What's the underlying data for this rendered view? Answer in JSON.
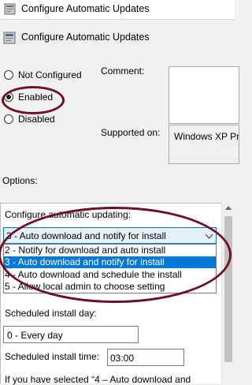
{
  "window": {
    "title": "Configure Automatic Updates",
    "header_title": "Configure Automatic Updates"
  },
  "state": {
    "not_configured_label": "Not Configured",
    "enabled_label": "Enabled",
    "disabled_label": "Disabled",
    "selected": "Enabled"
  },
  "comment_label": "Comment:",
  "supported_on": {
    "label": "Supported on:",
    "value": "Windows XP Pr"
  },
  "options_label": "Options:",
  "options": {
    "configure_label": "Configure automatic updating:",
    "combo_value": "3 - Auto download and notify for install",
    "dropdown_items": [
      "2 - Notify for download and auto install",
      "3 - Auto download and notify for install",
      "4 - Auto download and schedule the install",
      "5 - Allow local admin to choose setting"
    ],
    "selected_index": 1,
    "schedule_day_label": "Scheduled install day:",
    "schedule_day_value": "0 - Every day",
    "schedule_time_label": "Scheduled install time:",
    "schedule_time_value": "03:00",
    "note_text": "If you have selected “4 – Auto download and"
  },
  "colors": {
    "annotation": "#6e0f22",
    "selection": "#0078d7",
    "combo_fill": "#e5f1fb"
  },
  "icons": [
    "policy-icon",
    "radio-button",
    "chevron-down-icon",
    "scroll-up-arrow"
  ]
}
